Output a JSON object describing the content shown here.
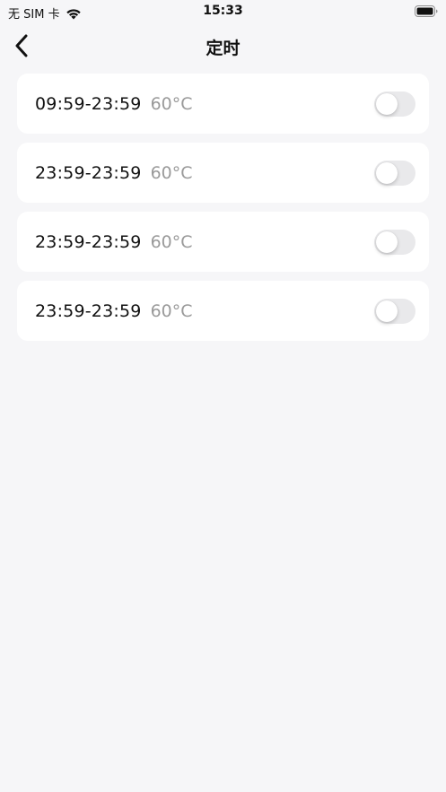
{
  "status_bar": {
    "carrier": "无 SIM 卡",
    "time": "15:33"
  },
  "nav": {
    "title": "定时"
  },
  "schedules": [
    {
      "time_range": "09:59-23:59",
      "temperature": "60°C",
      "enabled": false
    },
    {
      "time_range": "23:59-23:59",
      "temperature": "60°C",
      "enabled": false
    },
    {
      "time_range": "23:59-23:59",
      "temperature": "60°C",
      "enabled": false
    },
    {
      "time_range": "23:59-23:59",
      "temperature": "60°C",
      "enabled": false
    }
  ],
  "colors": {
    "background": "#f6f6f8",
    "card": "#ffffff",
    "toggle_off": "#e9e9eb",
    "secondary_text": "#9a9a9a"
  }
}
